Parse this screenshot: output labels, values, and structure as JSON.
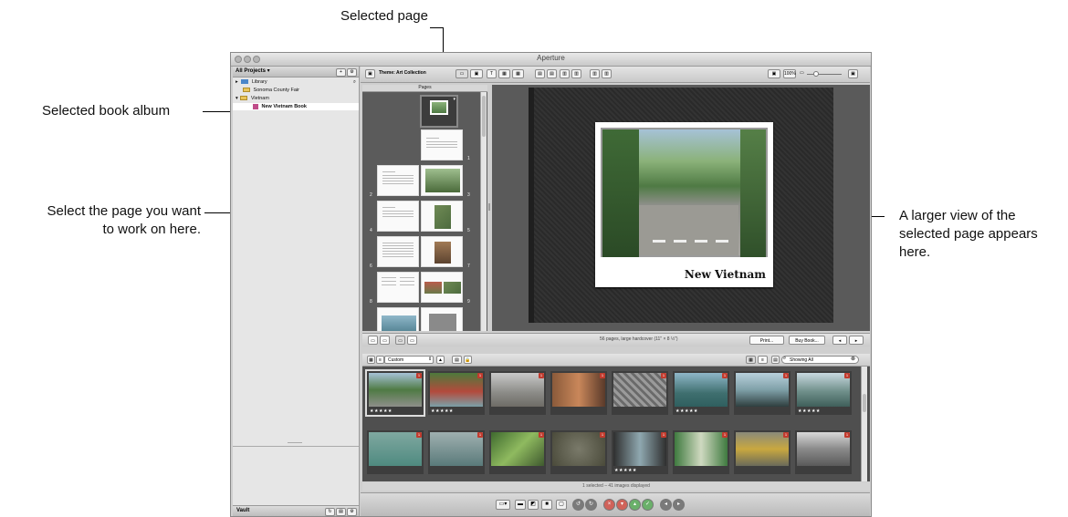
{
  "callouts": {
    "selected_page": "Selected page",
    "selected_album": "Selected book album",
    "select_page_line1": "Select the page you want",
    "select_page_line2": "to work on here.",
    "larger_view_line1": "A larger view of the",
    "larger_view_line2": "selected page appears",
    "larger_view_line3": "here."
  },
  "window": {
    "title": "Aperture"
  },
  "projects": {
    "header": "All Projects",
    "items": [
      {
        "label": "Library",
        "selected": false
      },
      {
        "label": "Sonoma County Fair",
        "selected": false
      },
      {
        "label": "Vietnam",
        "selected": false
      },
      {
        "label": "New Vietnam Book",
        "selected": true
      }
    ],
    "vault_label": "Vault"
  },
  "toolbar": {
    "theme_label": "Theme: Art Collection",
    "zoom_label": "100%"
  },
  "pages_pane": {
    "header": "Pages",
    "page_numbers": [
      "1",
      "2",
      "3",
      "4",
      "5",
      "6",
      "7",
      "8",
      "9"
    ]
  },
  "viewer": {
    "cover_title": "New Vietnam"
  },
  "viewer_bar": {
    "status": "56 pages, large hardcover (11\" × 8 ½\")",
    "print_label": "Print...",
    "buy_label": "Buy Book..."
  },
  "browser": {
    "sort_option": "Custom",
    "search_placeholder": "Showing All",
    "status": "1 selected – 41 images displayed",
    "stars": "★★★★★",
    "badge": "1"
  },
  "colors": {
    "accent_red": "#c23b2e",
    "window_bg": "#cfcfcf",
    "viewer_bg": "#5a5a5a"
  }
}
